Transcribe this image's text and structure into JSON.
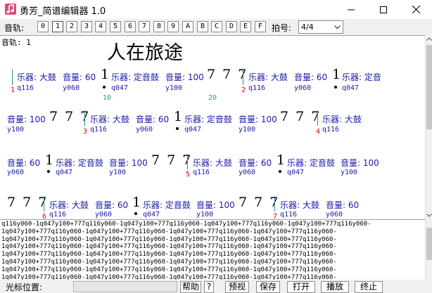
{
  "window": {
    "title": "勇芳_简谱编辑器 1.0",
    "minimize_icon": "minimize-icon",
    "maximize_icon": "maximize-icon",
    "close_icon": "close-icon"
  },
  "toolbar": {
    "track_label": "音轨:",
    "tracks": [
      "0",
      "1",
      "2",
      "3",
      "4",
      "5",
      "6",
      "7",
      "8",
      "9",
      "A",
      "B",
      "C",
      "D",
      "E",
      "F"
    ],
    "selected_track": "1",
    "meter_label": "拍号:",
    "meter_value": "4/4"
  },
  "score": {
    "track_info": "音轨: 1",
    "song_title": "人在旅途",
    "measure_numbers": [
      "1",
      "2",
      "3",
      "4",
      "5",
      "6",
      "7"
    ],
    "position_markers": [
      "10",
      "20"
    ],
    "instrument_big_drum": "乐器: 大鼓",
    "instrument_tuned_drum": "乐器: 定音鼓",
    "instrument_partial": "乐器: 定音",
    "volume_60": "音量: 60",
    "volume_100": "音量: 100",
    "code_q116": "q116",
    "code_y060": "y060",
    "code_q047": "q047",
    "code_y100": "y100",
    "note_one": "1",
    "note_777": "7 7 7"
  },
  "text_area": {
    "lines": [
      "q116y060-1q047y100+777q116y060-1q047y100+777q116y060-1q047y100+777q116y060-1q047y100+777q116y060-",
      "1q047y100+777q116y060-1q047y100+777q116y060-1q047y100+777q116y060-1q047y100+777q116y060-",
      "1q047y100+777q116y060-1q047y100+777q116y060-1q047y100+777q116y060-1q047y100+777q116y060-",
      "1q047y100+777q116y060-1q047y100+777q116y060-1q047y100+777q116y060-1q047y100+777q116y060-",
      "1q047y100+777q116y060-1q047y100+777q116y060-1q047y100+777q116y060-1q047y100+777q116y060-",
      "1q047y100+777q116y060-1q047y100+777q116y060-1q047y100+777q116y060-1q047y100+777q116y060-",
      "1q047y100+777q116y060-1q047y100+777q116y060-1q047y100+777q116y060-1q047y100+777q116y060-",
      "1q047y100+777q116y060-1q047y100+777q116y060-1q047y100+777q116y060-1q047y100+777q116y060-"
    ]
  },
  "status": {
    "cursor_label": "光标位置:",
    "help_button": "帮助",
    "help_icon_button": "?",
    "preview_button": "预视",
    "save_button": "保存",
    "open_button": "打开",
    "play_button": "播放",
    "stop_button": "终止"
  }
}
